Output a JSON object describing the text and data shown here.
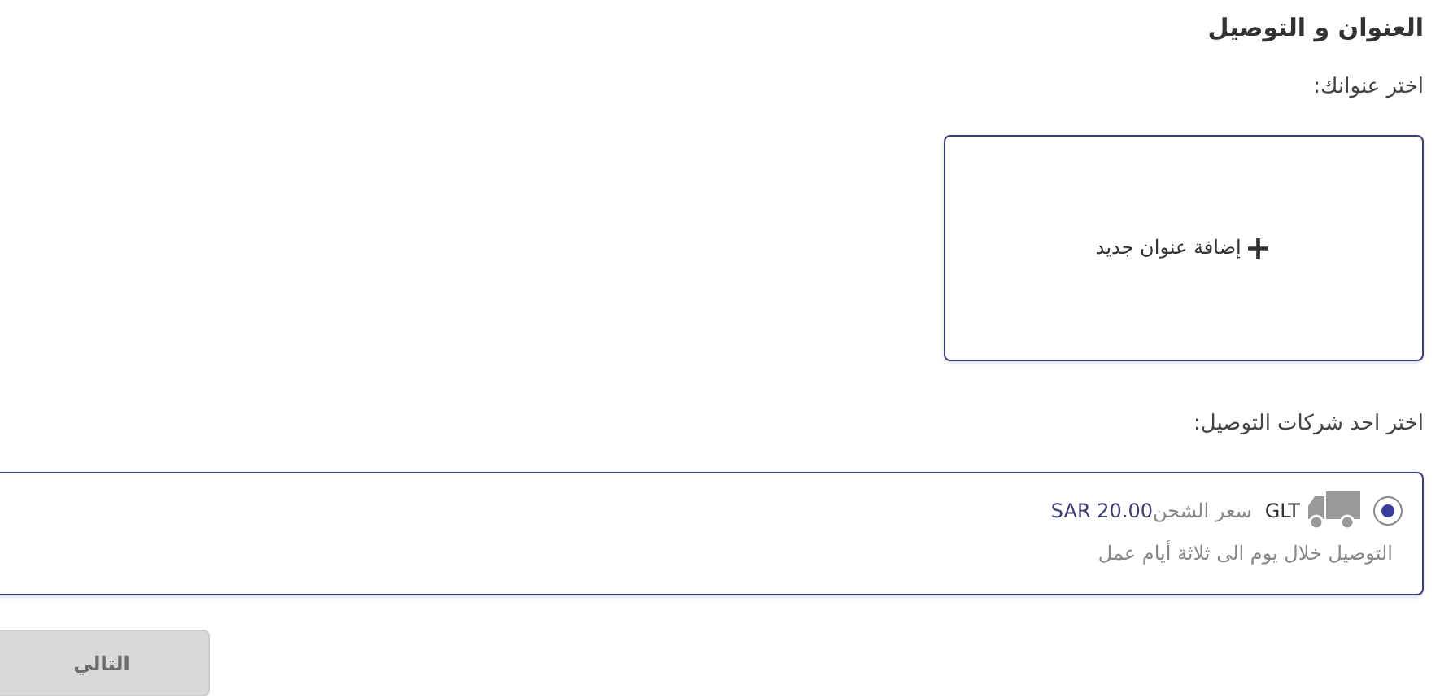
{
  "title": "العنوان و التوصيل",
  "address_label": "اختر عنوانك:",
  "add_address": {
    "icon": "+",
    "label": "إضافة عنوان جديد"
  },
  "carrier_label": "اختر احد شركات التوصيل:",
  "carriers": [
    {
      "name": "GLT",
      "price_label": "سعر الشحن",
      "price": "SAR 20.00",
      "description": "التوصيل خلال يوم الى ثلاثة أيام عمل",
      "selected": true
    }
  ],
  "next_button": {
    "label": "التالي",
    "disabled": true
  }
}
